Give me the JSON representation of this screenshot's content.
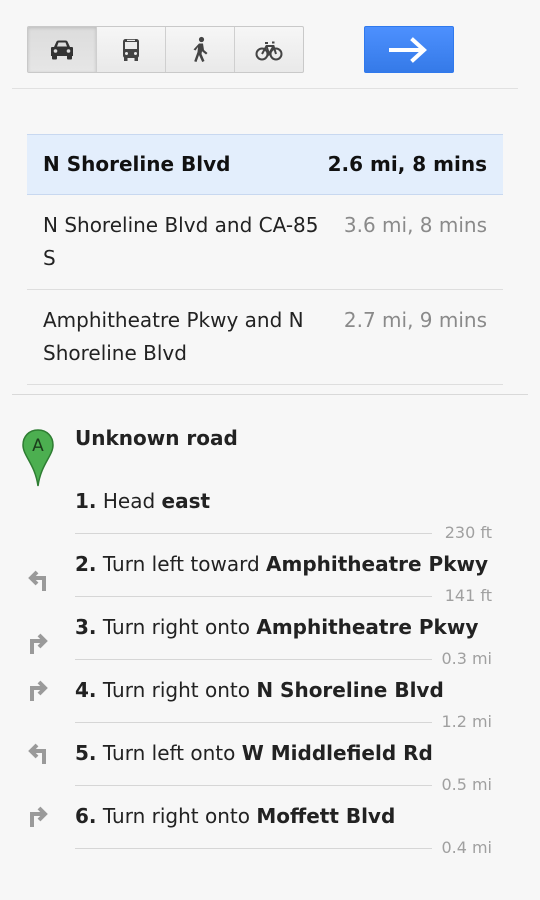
{
  "modes": [
    {
      "icon": "car-icon",
      "name": "mode-driving"
    },
    {
      "icon": "bus-icon",
      "name": "mode-transit"
    },
    {
      "icon": "walk-icon",
      "name": "mode-walking"
    },
    {
      "icon": "bike-icon",
      "name": "mode-bicycling"
    }
  ],
  "go_icon": "arrow-right-icon",
  "accent": "#4d90fe",
  "routes": [
    {
      "name": "N Shoreline Blvd",
      "dist": "2.6 mi, 8 mins"
    },
    {
      "name": "N Shoreline Blvd and CA-85 S",
      "dist": "3.6 mi, 8 mins"
    },
    {
      "name": "Amphitheatre Pkwy and N Shoreline Blvd",
      "dist": "2.7 mi, 9 mins"
    }
  ],
  "start": {
    "marker": "A",
    "road": "Unknown road"
  },
  "steps": [
    {
      "num": "1.",
      "pre": " Head ",
      "bold": "east",
      "dist": "230 ft"
    },
    {
      "num": "2.",
      "pre": " Turn left toward ",
      "bold": "Amphitheatre Pkwy",
      "dist": "141 ft"
    },
    {
      "num": "3.",
      "pre": " Turn right onto ",
      "bold": "Amphitheatre Pkwy",
      "dist": "0.3 mi"
    },
    {
      "num": "4.",
      "pre": " Turn right onto ",
      "bold": "N Shoreline Blvd",
      "dist": "1.2 mi"
    },
    {
      "num": "5.",
      "pre": " Turn left onto ",
      "bold": "W Middlefield Rd",
      "dist": "0.5 mi"
    },
    {
      "num": "6.",
      "pre": " Turn right onto ",
      "bold": "Moffett Blvd",
      "dist": "0.4 mi"
    }
  ]
}
